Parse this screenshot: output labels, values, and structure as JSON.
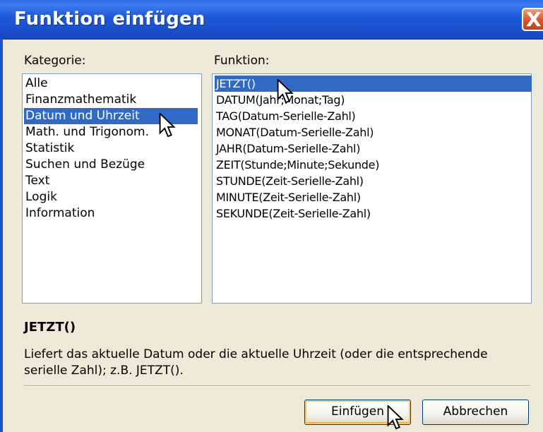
{
  "window": {
    "title": "Funktion einfügen",
    "close_symbol": "X"
  },
  "category": {
    "label": "Kategorie:",
    "items": [
      "Alle",
      "Finanzmathematik",
      "Datum und Uhrzeit",
      "Math. und Trigonom.",
      "Statistik",
      "Suchen und Bezüge",
      "Text",
      "Logik",
      "Information"
    ],
    "selected": "Datum und Uhrzeit"
  },
  "function": {
    "label": "Funktion:",
    "items": [
      "JETZT()",
      "DATUM(Jahr;Monat;Tag)",
      "TAG(Datum-Serielle-Zahl)",
      "MONAT(Datum-Serielle-Zahl)",
      "JAHR(Datum-Serielle-Zahl)",
      "ZEIT(Stunde;Minute;Sekunde)",
      "STUNDE(Zeit-Serielle-Zahl)",
      "MINUTE(Zeit-Serielle-Zahl)",
      "SEKUNDE(Zeit-Serielle-Zahl)"
    ],
    "selected": "JETZT()"
  },
  "selected_function_name": "JETZT()",
  "description": "Liefert das aktuelle Datum oder die aktuelle Uhrzeit (oder die entsprechende serielle Zahl); z.B. JETZT().",
  "buttons": {
    "insert": "Einfügen",
    "cancel": "Abbrechen"
  },
  "colors": {
    "title_bar": "#1e58d6",
    "selection": "#316ac5",
    "dialog_bg": "#ece9d8"
  }
}
